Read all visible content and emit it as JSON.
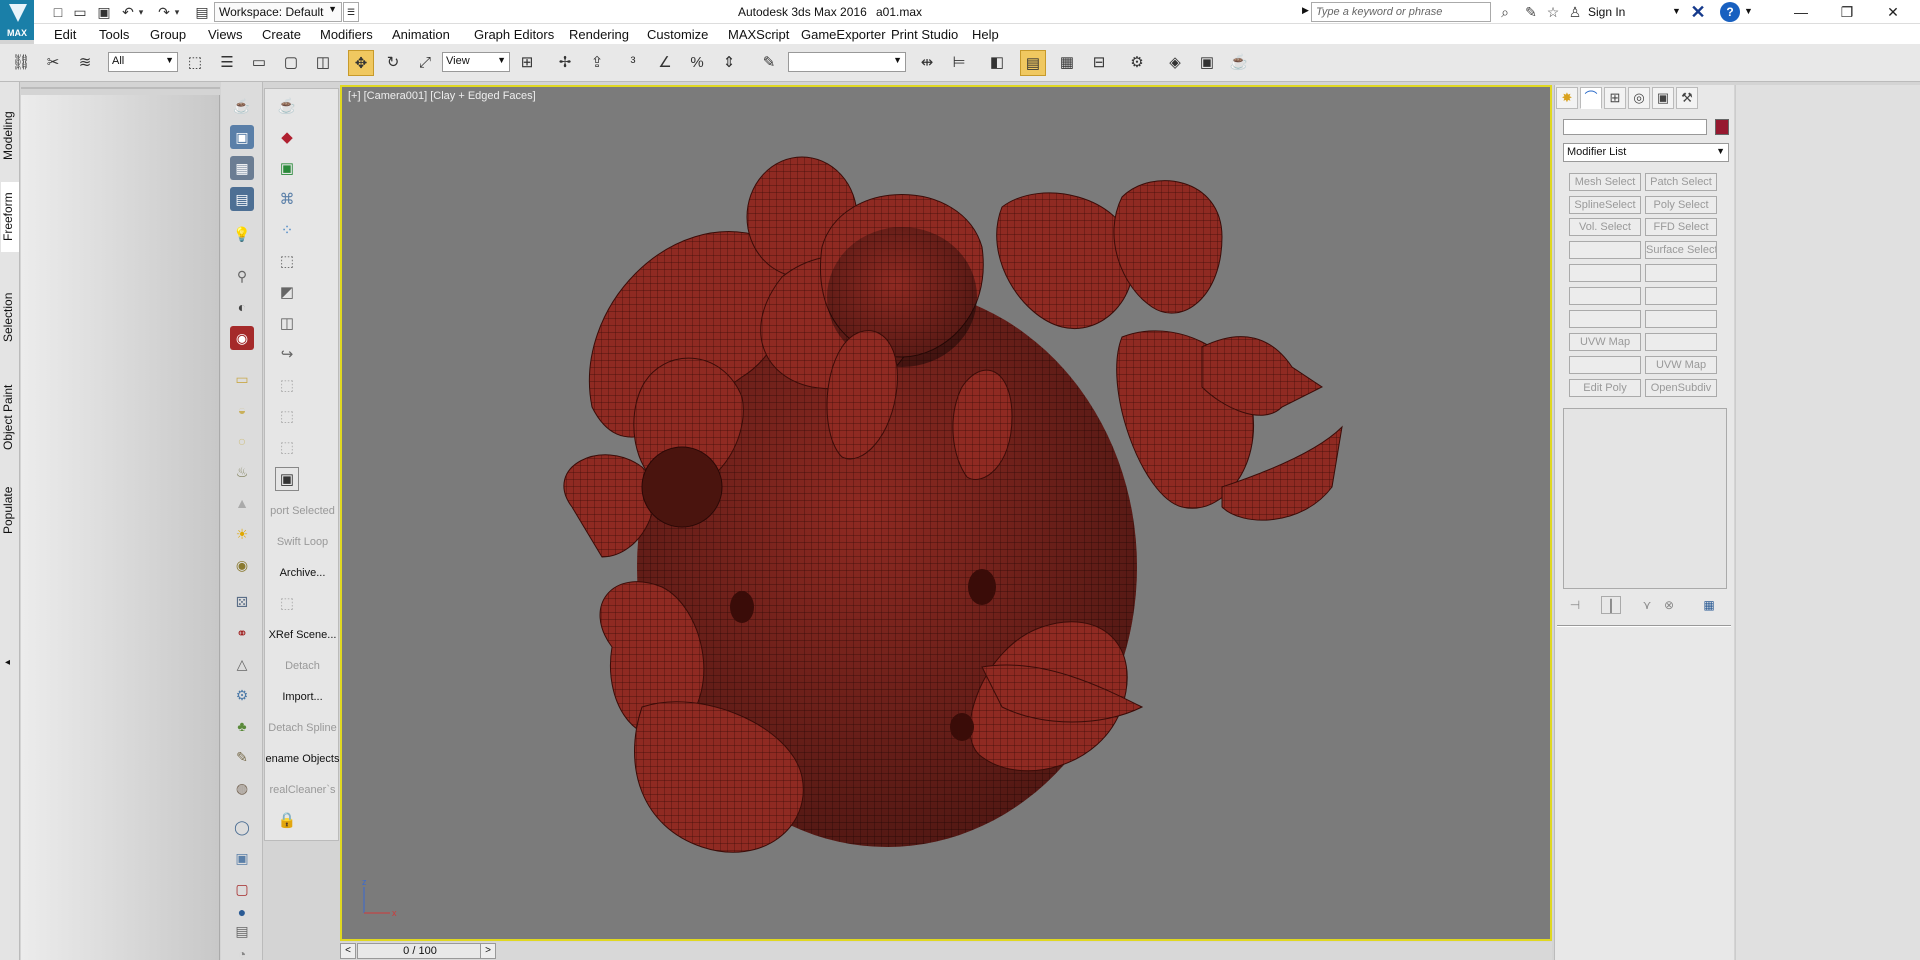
{
  "titlebar": {
    "logo_text": "MAX",
    "workspace": "Workspace: Default",
    "app_title": "Autodesk 3ds Max 2016",
    "file_name": "a01.max",
    "search_placeholder": "Type a keyword or phrase",
    "sign_in": "Sign In",
    "help": "?"
  },
  "menu": [
    "Edit",
    "Tools",
    "Group",
    "Views",
    "Create",
    "Modifiers",
    "Animation",
    "Graph Editors",
    "Rendering",
    "Customize",
    "MAXScript",
    "GameExporter",
    "Print Studio",
    "Help"
  ],
  "toolbar": {
    "selection_filter": "All",
    "reference_coord": "View",
    "named_selection": ""
  },
  "ribbon_tabs": [
    "Modeling",
    "Freeform",
    "Selection",
    "Object Paint",
    "Populate"
  ],
  "tool_column": {
    "labels": [
      "port Selected",
      "Swift Loop",
      "Archive...",
      "XRef Scene...",
      "Detach",
      "Import...",
      "Detach Spline",
      "ename Objects",
      "realCleaner`s"
    ]
  },
  "viewport": {
    "label": "[+] [Camera001] [Clay + Edged Faces]",
    "axis_z": "z",
    "axis_x": "x"
  },
  "timeslider": {
    "frame": "0 / 100",
    "prev": "<",
    "next": ">"
  },
  "command_panel": {
    "modifier_list": "Modifier List",
    "object_color": "#96182f",
    "modifier_buttons": [
      [
        "Mesh Select",
        "Patch Select"
      ],
      [
        "SplineSelect",
        "Poly Select"
      ],
      [
        "Vol. Select",
        "FFD Select"
      ],
      [
        "",
        "Surface Select"
      ],
      [
        "",
        ""
      ],
      [
        "",
        ""
      ],
      [
        "",
        ""
      ],
      [
        "UVW Map",
        ""
      ],
      [
        "",
        "UVW Map"
      ],
      [
        "Edit Poly",
        "OpenSubdiv"
      ]
    ]
  },
  "colors": {
    "accent": "#1a7fa8",
    "viewport_bg": "#7b7b7b",
    "viewport_border": "#e0d820",
    "mesh": "#8f2a22",
    "active_tool": "#f0c860"
  }
}
